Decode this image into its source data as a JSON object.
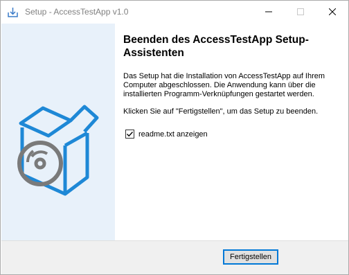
{
  "window": {
    "title": "Setup - AccessTestApp v1.0",
    "icon": "installer-icon",
    "controls": {
      "minimize": "minimize-icon",
      "maximize": "maximize-icon",
      "close": "close-icon"
    }
  },
  "sidebar": {
    "image": "software-box-cd-icon",
    "accent_color": "#1e88d6",
    "background": "#e8f1fa"
  },
  "main": {
    "heading": "Beenden des AccessTestApp Setup-Assistenten",
    "paragraph1": "Das Setup hat die Installation von AccessTestApp auf Ihrem Computer abgeschlossen. Die Anwendung kann über die installierten Programm-Verknüpfungen gestartet werden.",
    "paragraph2": "Klicken Sie auf \"Fertigstellen\", um das Setup zu beenden.",
    "checkbox": {
      "label": "readme.txt anzeigen",
      "checked": true
    }
  },
  "footer": {
    "finish_label": "Fertigstellen"
  }
}
